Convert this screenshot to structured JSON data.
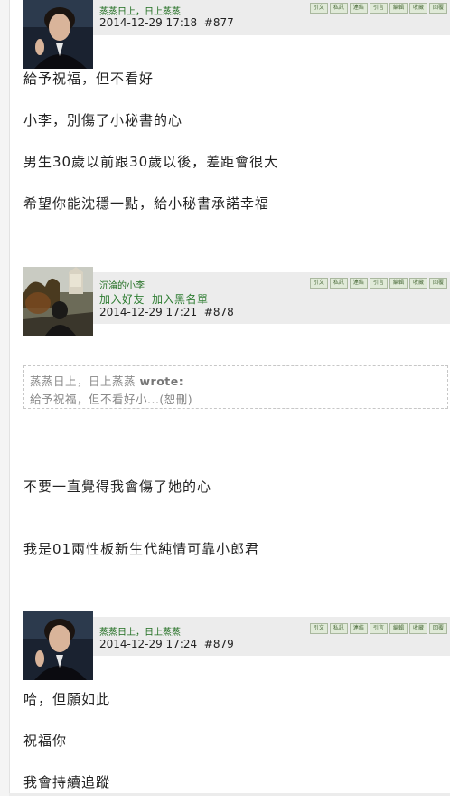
{
  "action_buttons": [
    "引文",
    "私訊",
    "連結",
    "引言",
    "編輯",
    "收藏",
    "回覆"
  ],
  "posts": [
    {
      "author": "蒸蒸日上，日上蒸蒸",
      "date": "2014-12-29 17:18",
      "number": "#877",
      "paragraphs": [
        "給予祝福，但不看好",
        "小李，別傷了小秘書的心",
        "男生30歲以前跟30歲以後，差距會很大",
        "希望你能沈穩一點，給小秘書承諾幸福"
      ]
    },
    {
      "author": "沉淪的小李",
      "add_friend": "加入好友",
      "add_blacklist": "加入黑名單",
      "date": "2014-12-29 17:21",
      "number": "#878",
      "quote": {
        "author": "蒸蒸日上，日上蒸蒸",
        "wrote": "wrote:",
        "text": "給予祝福，但不看好小...(恕刪)"
      },
      "paragraphs": [
        "不要一直覺得我會傷了她的心",
        "我是01兩性板新生代純情可靠小郎君"
      ]
    },
    {
      "author": "蒸蒸日上，日上蒸蒸",
      "date": "2014-12-29 17:24",
      "number": "#879",
      "paragraphs": [
        "哈，但願如此",
        "祝福你",
        "我會持續追蹤"
      ]
    }
  ]
}
